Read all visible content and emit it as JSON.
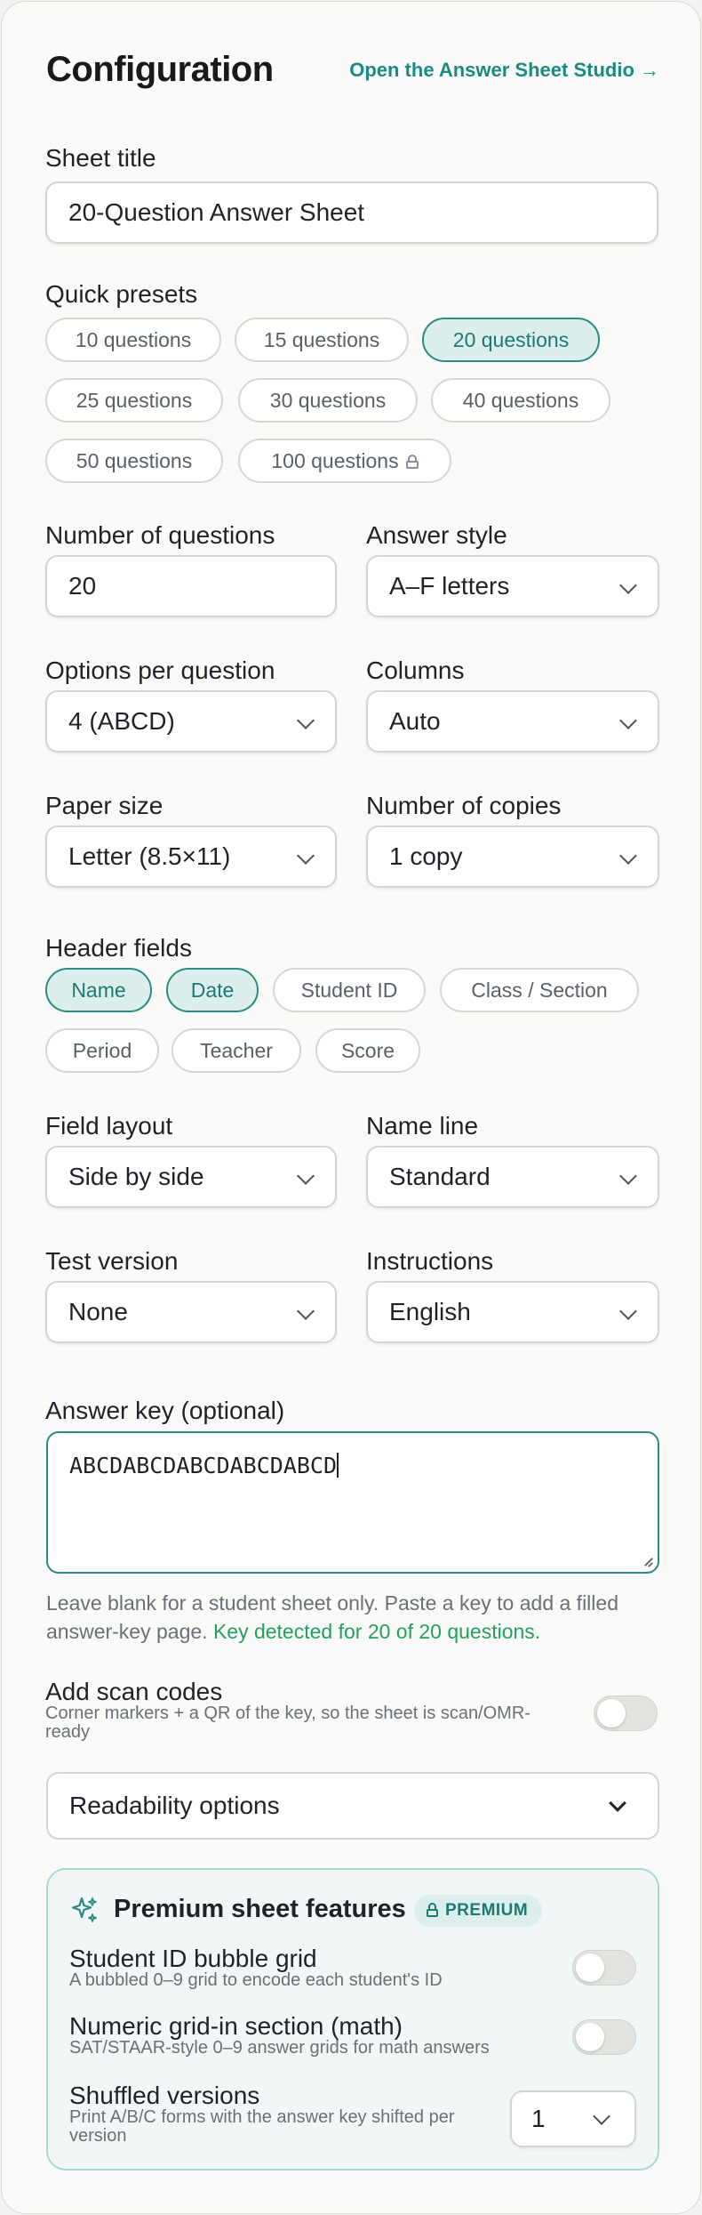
{
  "header": {
    "title": "Configuration",
    "studio_link": "Open the Answer Sheet Studio →"
  },
  "sheet_title": {
    "label": "Sheet title",
    "value": "20-Question Answer Sheet"
  },
  "presets": {
    "label": "Quick presets",
    "items": [
      {
        "label": "10 questions",
        "active": false,
        "locked": false
      },
      {
        "label": "15 questions",
        "active": false,
        "locked": false
      },
      {
        "label": "20 questions",
        "active": true,
        "locked": false
      },
      {
        "label": "25 questions",
        "active": false,
        "locked": false
      },
      {
        "label": "30 questions",
        "active": false,
        "locked": false
      },
      {
        "label": "40 questions",
        "active": false,
        "locked": false
      },
      {
        "label": "50 questions",
        "active": false,
        "locked": false
      },
      {
        "label": "100 questions",
        "active": false,
        "locked": true
      }
    ]
  },
  "fields": {
    "num_questions": {
      "label": "Number of questions",
      "value": "20"
    },
    "answer_style": {
      "label": "Answer style",
      "value": "A–F letters"
    },
    "options_per_question": {
      "label": "Options per question",
      "value": "4 (ABCD)"
    },
    "columns": {
      "label": "Columns",
      "value": "Auto"
    },
    "paper_size": {
      "label": "Paper size",
      "value": "Letter (8.5×11)"
    },
    "copies": {
      "label": "Number of copies",
      "value": "1 copy"
    },
    "field_layout": {
      "label": "Field layout",
      "value": "Side by side"
    },
    "name_line": {
      "label": "Name line",
      "value": "Standard"
    },
    "test_version": {
      "label": "Test version",
      "value": "None"
    },
    "instructions": {
      "label": "Instructions",
      "value": "English"
    }
  },
  "header_fields": {
    "label": "Header fields",
    "items": [
      {
        "label": "Name",
        "active": true
      },
      {
        "label": "Date",
        "active": true
      },
      {
        "label": "Student ID",
        "active": false
      },
      {
        "label": "Class / Section",
        "active": false
      },
      {
        "label": "Period",
        "active": false
      },
      {
        "label": "Teacher",
        "active": false
      },
      {
        "label": "Score",
        "active": false
      }
    ]
  },
  "answer_key": {
    "label": "Answer key (optional)",
    "value": "ABCDABCDABCDABCDABCD",
    "help": "Leave blank for a student sheet only. Paste a key to add a filled answer-key page.",
    "status": "Key detected for 20 of 20 questions."
  },
  "scan_codes": {
    "label": "Add scan codes",
    "desc": "Corner markers + a QR of the key, so the sheet is scan/OMR-ready",
    "enabled": false
  },
  "readability": {
    "label": "Readability options"
  },
  "premium": {
    "title": "Premium sheet features",
    "badge": "PREMIUM",
    "student_id": {
      "label": "Student ID bubble grid",
      "desc": "A bubbled 0–9 grid to encode each student's ID",
      "enabled": false
    },
    "grid_in": {
      "label": "Numeric grid-in section (math)",
      "desc": "SAT/STAAR-style 0–9 answer grids for math answers",
      "enabled": false
    },
    "shuffled": {
      "label": "Shuffled versions",
      "desc": "Print A/B/C forms with the answer key shifted per version",
      "value": "1"
    }
  },
  "colors": {
    "accent": "#2c8a80",
    "accent_bg": "#dcefec",
    "success": "#23a05c"
  }
}
